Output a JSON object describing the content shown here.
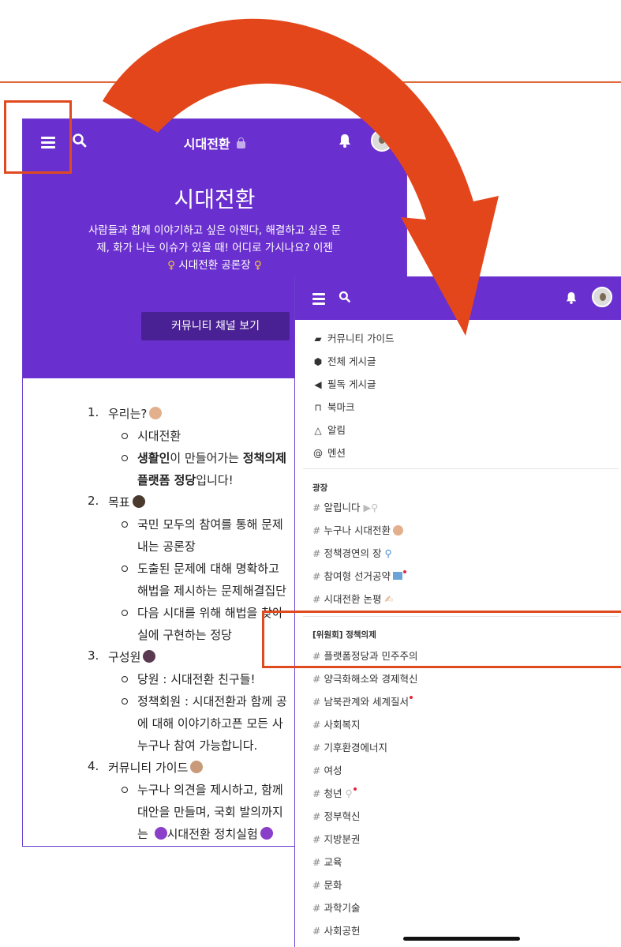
{
  "left_screen": {
    "header": {
      "title": "시대전환",
      "lock_icon": "lock-icon",
      "menu_icon": "hamburger-icon",
      "search_icon": "search-icon",
      "bell_icon": "bell-icon"
    },
    "hero": {
      "title": "시대전환",
      "description_line1": "사람들과 함께 이야기하고 싶은 아젠다, 해결하고 싶은 문",
      "description_line2": "제, 화가 나는 이슈가 있을 때! 어디로 가시나요? 이젠",
      "description_line3": "시대전환 공론장",
      "button_label": "커뮤니티 채널 보기"
    },
    "about": [
      {
        "num": "1.",
        "label": "우리는?"
      },
      {
        "sub": "시대전환"
      },
      {
        "sub_bold1": "생활인",
        "sub_rest1": "이 만들어가는 ",
        "sub_bold2": "정책의제"
      },
      {
        "sub_bold3": "플랫폼 정당",
        "sub_rest2": "입니다!"
      },
      {
        "num": "2.",
        "label": "목표"
      },
      {
        "sub": "국민 모두의 참여를 통해 문제"
      },
      {
        "sub": "내는 공론장"
      },
      {
        "sub": "도출된 문제에 대해 명확하고"
      },
      {
        "sub": "해법을 제시하는 문제해결집단"
      },
      {
        "sub": "다음 시대를 위해 해법을 찾아"
      },
      {
        "sub": "실에 구현하는 정당"
      },
      {
        "num": "3.",
        "label": "구성원"
      },
      {
        "sub": "당원 : 시대전환 친구들!"
      },
      {
        "sub": "정책회원 : 시대전환과 함께 공"
      },
      {
        "sub": "에 대해 이야기하고픈 모든 사"
      },
      {
        "sub": "누구나 참여 가능합니다."
      },
      {
        "num": "4.",
        "label": "커뮤니티 가이드"
      },
      {
        "sub": "누구나 의견을 제시하고, 함께"
      },
      {
        "sub": "대안을 만들며, 국회 발의까지"
      },
      {
        "sub_pre": "는",
        "sub": "시대전환 정치실험"
      }
    ]
  },
  "right_screen": {
    "menu": [
      {
        "icon": "book-icon",
        "label": "커뮤니티 가이드"
      },
      {
        "icon": "cube-icon",
        "label": "전체 게시글"
      },
      {
        "icon": "megaphone-icon",
        "label": "필독 게시글"
      },
      {
        "icon": "bookmark-icon",
        "label": "북마크"
      },
      {
        "icon": "bell-outline-icon",
        "label": "알림"
      },
      {
        "icon": "at-icon",
        "label": "멘션"
      }
    ],
    "section_plaza": "광장",
    "plaza_channels": [
      "알립니다",
      "누구나 시대전환",
      "정책경연의 장",
      "참여형 선거공약",
      "시대전환 논평"
    ],
    "section_committee": "[위원회] 정책의제",
    "committee_channels": [
      "플랫폼정당과 민주주의",
      "양극화해소와 경제혁신",
      "남북관계와 세계질서",
      "사회복지",
      "기후환경에너지",
      "여성",
      "청년",
      "정부혁신",
      "지방분권",
      "교육",
      "문화",
      "과학기술",
      "사회공헌"
    ],
    "hash": "#"
  },
  "colors": {
    "purple": "#6a2fcf",
    "button_purple": "#4a2194",
    "highlight": "#e04a1f"
  }
}
